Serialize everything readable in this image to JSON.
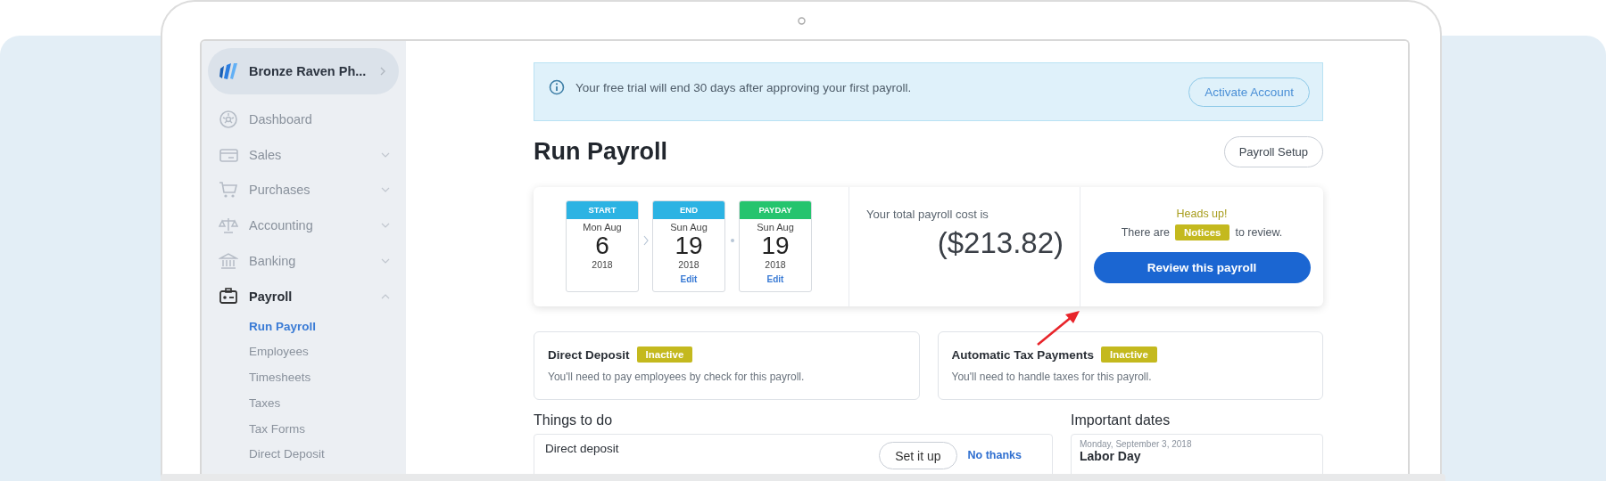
{
  "sidebar": {
    "company": "Bronze Raven Ph...",
    "items": [
      {
        "label": "Dashboard",
        "kind": "link",
        "selected": false
      },
      {
        "label": "Sales",
        "kind": "group",
        "expanded": false,
        "selected": false
      },
      {
        "label": "Purchases",
        "kind": "group",
        "expanded": false,
        "selected": false
      },
      {
        "label": "Accounting",
        "kind": "group",
        "expanded": false,
        "selected": false
      },
      {
        "label": "Banking",
        "kind": "group",
        "expanded": false,
        "selected": false
      },
      {
        "label": "Payroll",
        "kind": "group",
        "expanded": true,
        "selected": true,
        "children": [
          {
            "label": "Run Payroll",
            "selected": true
          },
          {
            "label": "Employees",
            "selected": false
          },
          {
            "label": "Timesheets",
            "selected": false
          },
          {
            "label": "Taxes",
            "selected": false
          },
          {
            "label": "Tax Forms",
            "selected": false
          },
          {
            "label": "Direct Deposit",
            "selected": false
          }
        ]
      }
    ]
  },
  "banner": {
    "text": "Your free trial will end 30 days after approving your first payroll.",
    "button": "Activate Account"
  },
  "title": "Run Payroll",
  "setup_button": "Payroll Setup",
  "summary": {
    "dates": [
      {
        "label": "START",
        "color": "#2cb3e3",
        "weekday_month": "Mon Aug",
        "day": "6",
        "year": "2018"
      },
      {
        "label": "END",
        "color": "#2cb3e3",
        "weekday_month": "Sun Aug",
        "day": "19",
        "year": "2018",
        "edit": "Edit"
      },
      {
        "label": "PAYDAY",
        "color": "#25c46e",
        "weekday_month": "Sun Aug",
        "day": "19",
        "year": "2018",
        "edit": "Edit"
      }
    ],
    "cost_label": "Your total payroll cost is",
    "cost": "($213.82)",
    "heads_up": "Heads up!",
    "notice_before": "There are",
    "notice_badge": "Notices",
    "notice_after": "to review.",
    "review_button": "Review this payroll"
  },
  "status_cards": [
    {
      "title": "Direct Deposit",
      "badge": "Inactive",
      "text": "You'll need to pay employees by check for this payroll."
    },
    {
      "title": "Automatic Tax Payments",
      "badge": "Inactive",
      "text": "You'll need to handle taxes for this payroll."
    }
  ],
  "todo": {
    "heading": "Things to do",
    "items": [
      {
        "title": "Direct deposit",
        "button": "Set it up",
        "link": "No thanks"
      }
    ]
  },
  "important_dates": {
    "heading": "Important dates",
    "entries": [
      {
        "date": "Monday, September 3, 2018",
        "title": "Labor Day"
      }
    ]
  }
}
